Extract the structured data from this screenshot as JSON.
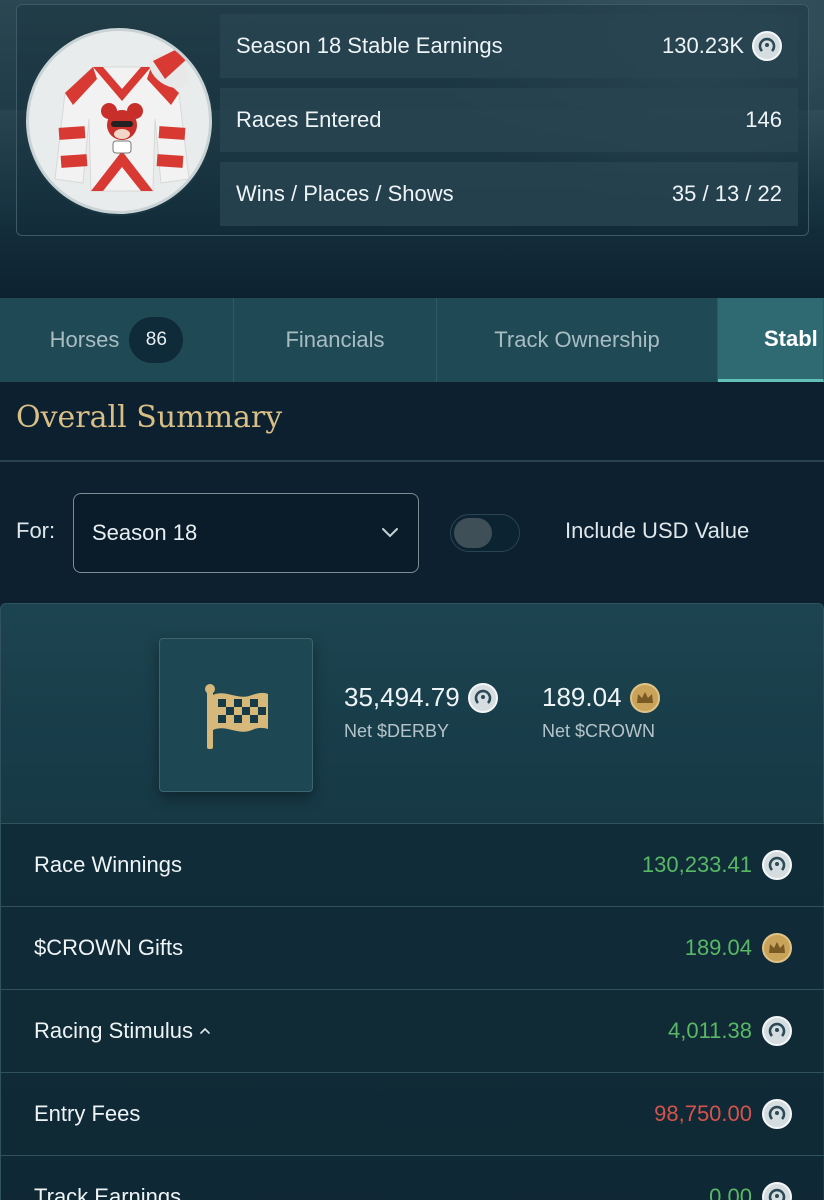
{
  "profile": {
    "stats": [
      {
        "label": "Season 18 Stable Earnings",
        "value": "130.23K",
        "icon": "derby-coin-icon"
      },
      {
        "label": "Races Entered",
        "value": "146"
      },
      {
        "label": "Wins / Places / Shows",
        "value": "35 / 13 / 22"
      }
    ]
  },
  "tabs": [
    {
      "label": "Horses",
      "badge": "86"
    },
    {
      "label": "Financials"
    },
    {
      "label": "Track Ownership"
    },
    {
      "label": "Stabl"
    }
  ],
  "summary": {
    "title": "Overall Summary",
    "for_label": "For:",
    "season_selected": "Season 18",
    "toggle_label": "Include USD Value",
    "toggle_on": false
  },
  "net": {
    "derby_value": "35,494.79",
    "derby_label": "Net $DERBY",
    "crown_value": "189.04",
    "crown_label": "Net $CROWN"
  },
  "rows": [
    {
      "label": "Race Winnings",
      "value": "130,233.41",
      "tone": "green",
      "icon": "derby-coin-icon"
    },
    {
      "label": "$CROWN Gifts",
      "value": "189.04",
      "tone": "green",
      "icon": "crown-coin-icon"
    },
    {
      "label": "Racing Stimulus",
      "value": "4,011.38",
      "tone": "green",
      "icon": "derby-coin-icon",
      "expandable": true
    },
    {
      "label": "Entry Fees",
      "value": "98,750.00",
      "tone": "red",
      "icon": "derby-coin-icon"
    },
    {
      "label": "Track Earnings",
      "value": "0.00",
      "tone": "green",
      "icon": "derby-coin-icon"
    }
  ],
  "colors": {
    "accent_gold": "#d9bf86",
    "positive": "#58b865",
    "negative": "#d4534c",
    "active_tab": "#2f6a72"
  }
}
